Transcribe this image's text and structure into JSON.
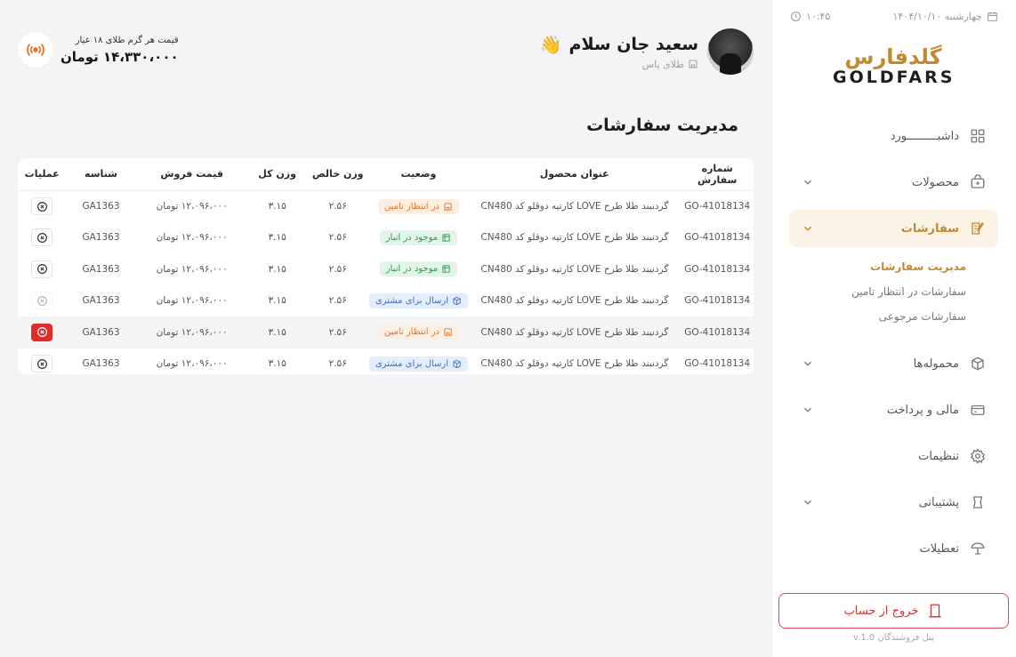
{
  "sidebar": {
    "date": "چهارشنبه ۱۴۰۴/۱۰/۱۰",
    "time": "۱۰:۴۵",
    "logo_fa": "گلدفارس",
    "logo_en": "GOLDFARS",
    "menu": [
      {
        "label": "داشبـــــــــورد",
        "icon": "dashboard-icon",
        "expandable": false
      },
      {
        "label": "محصولات",
        "icon": "products-icon",
        "expandable": true
      },
      {
        "label": "سفارشات",
        "icon": "orders-icon",
        "expandable": true,
        "active": true
      },
      {
        "label": "محموله‌ها",
        "icon": "shipments-icon",
        "expandable": true
      },
      {
        "label": "مالی و پرداخت",
        "icon": "wallet-icon",
        "expandable": true
      },
      {
        "label": "تنظیمات",
        "icon": "settings-icon",
        "expandable": false
      },
      {
        "label": "پشتیبانی",
        "icon": "support-icon",
        "expandable": true
      },
      {
        "label": "تعطیلات",
        "icon": "holiday-icon",
        "expandable": false
      }
    ],
    "submenu": [
      "مدیریت سفارشات",
      "سفارشات در انتظار تامین",
      "سفارشات مرجوعی"
    ],
    "logout": "خروج از حساب",
    "version": "پنل فروشندگان v.1.0"
  },
  "header": {
    "user_name": "سعید جان سلام",
    "wave": "👋",
    "shop": "طلای پاس",
    "price_label": "قیمت هر گرم طلای ۱۸ عیار",
    "price_value": "۱۴،۳۳۰،۰۰۰ تومان"
  },
  "page_title": "مدیریت سفارشات",
  "table": {
    "headers": [
      "شماره سفارش",
      "عنوان محصول",
      "وضعیت",
      "وزن خالص",
      "وزن کل",
      "قیمت فروش",
      "شناسه",
      "عملیات"
    ],
    "rows": [
      {
        "order": "GO-41018134",
        "product": "گردنبند طلا طرح LOVE کارتیه دوقلو کد CN480",
        "status": "در انتظار تامین",
        "status_type": "orange",
        "net": "۲.۵۶",
        "total": "۳.۱۵",
        "price": "۱۲،۰۹۶،۰۰۰ تومان",
        "sku": "GA1363",
        "action": "normal"
      },
      {
        "order": "GO-41018134",
        "product": "گردنبند طلا طرح LOVE کارتیه دوقلو کد CN480",
        "status": "موجود در انبار",
        "status_type": "green",
        "net": "۲.۵۶",
        "total": "۳.۱۵",
        "price": "۱۲،۰۹۶،۰۰۰ تومان",
        "sku": "GA1363",
        "action": "normal"
      },
      {
        "order": "GO-41018134",
        "product": "گردنبند طلا طرح LOVE کارتیه دوقلو کد CN480",
        "status": "موجود در انبار",
        "status_type": "green",
        "net": "۲.۵۶",
        "total": "۳.۱۵",
        "price": "۱۲،۰۹۶،۰۰۰ تومان",
        "sku": "GA1363",
        "action": "normal"
      },
      {
        "order": "GO-41018134",
        "product": "گردنبند طلا طرح LOVE کارتیه دوقلو کد CN480",
        "status": "ارسال برای مشتری",
        "status_type": "blue",
        "net": "۲.۵۶",
        "total": "۳.۱۵",
        "price": "۱۲،۰۹۶،۰۰۰ تومان",
        "sku": "GA1363",
        "action": "faded"
      },
      {
        "order": "GO-41018134",
        "product": "گردنبند طلا طرح LOVE کارتیه دوقلو کد CN480",
        "status": "در انتظار تامین",
        "status_type": "orange",
        "net": "۲.۵۶",
        "total": "۳.۱۵",
        "price": "۱۲،۰۹۶،۰۰۰ تومان",
        "sku": "GA1363",
        "action": "red",
        "highlight": true
      },
      {
        "order": "GO-41018134",
        "product": "گردنبند طلا طرح LOVE کارتیه دوقلو کد CN480",
        "status": "ارسال برای مشتری",
        "status_type": "blue",
        "net": "۲.۵۶",
        "total": "۳.۱۵",
        "price": "۱۲،۰۹۶،۰۰۰ تومان",
        "sku": "GA1363",
        "action": "normal"
      }
    ]
  },
  "colors": {
    "accent": "#c08a32",
    "danger": "#e22b2b"
  }
}
